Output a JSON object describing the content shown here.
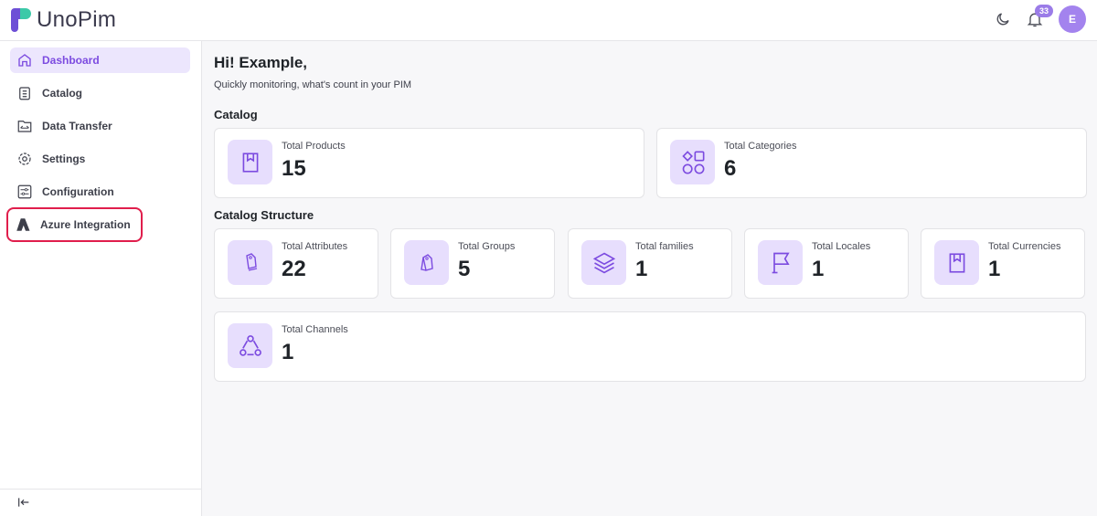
{
  "header": {
    "app_name": "UnoPim",
    "notification_count": "33",
    "avatar_initial": "E"
  },
  "sidebar": {
    "items": [
      {
        "label": "Dashboard",
        "icon": "home-icon",
        "active": true
      },
      {
        "label": "Catalog",
        "icon": "clipboard-list-icon"
      },
      {
        "label": "Data Transfer",
        "icon": "folder-transfer-icon"
      },
      {
        "label": "Settings",
        "icon": "gear-icon"
      },
      {
        "label": "Configuration",
        "icon": "sliders-icon"
      },
      {
        "label": "Azure Integration",
        "icon": "azure-icon"
      }
    ]
  },
  "main": {
    "greeting": "Hi! Example,",
    "subtitle": "Quickly monitoring, what's count in your PIM",
    "catalog_title": "Catalog",
    "structure_title": "Catalog Structure",
    "catalog": [
      {
        "label": "Total Products",
        "value": "15",
        "icon": "bookmark-book-icon"
      },
      {
        "label": "Total Categories",
        "value": "6",
        "icon": "shapes-icon"
      }
    ],
    "structure": [
      {
        "label": "Total Attributes",
        "value": "22",
        "icon": "tag-icon"
      },
      {
        "label": "Total Groups",
        "value": "5",
        "icon": "tags-icon"
      },
      {
        "label": "Total families",
        "value": "1",
        "icon": "layers-icon"
      },
      {
        "label": "Total Locales",
        "value": "1",
        "icon": "flag-icon"
      },
      {
        "label": "Total Currencies",
        "value": "1",
        "icon": "bookmark-book-icon"
      },
      {
        "label": "Total Channels",
        "value": "1",
        "icon": "channels-icon"
      }
    ]
  },
  "colors": {
    "accent": "#7c4be0",
    "icon_bg": "#e7defd",
    "highlight": "#e01e4c"
  }
}
